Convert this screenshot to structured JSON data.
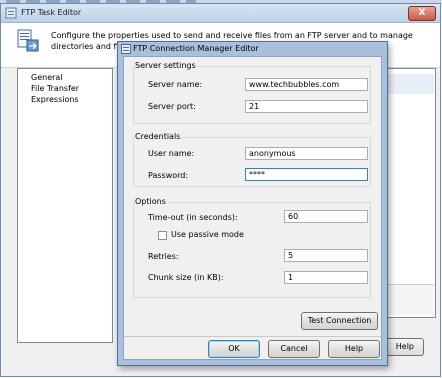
{
  "outer_window": {
    "title": "FTP Task Editor",
    "close_glyph": "X",
    "description": "Configure the properties used to send and receive files from an FTP server and to manage directories and files on local and remote servers.",
    "nav_items": [
      "General",
      "File Transfer",
      "Expressions"
    ],
    "help_label": "Help"
  },
  "dialog": {
    "title": "FTP Connection Manager Editor",
    "server_settings": {
      "title": "Server settings",
      "server_name_label": "Server name:",
      "server_name_value": "www.techbubbles.com",
      "server_port_label": "Server port:",
      "server_port_value": "21"
    },
    "credentials": {
      "title": "Credentials",
      "user_name_label": "User name:",
      "user_name_value": "anonymous",
      "password_label": "Password:",
      "password_value": "****"
    },
    "options": {
      "title": "Options",
      "timeout_label": "Time-out (in seconds):",
      "timeout_value": "60",
      "passive_label": "Use passive mode",
      "passive_checked": false,
      "retries_label": "Retries:",
      "retries_value": "5",
      "chunk_label": "Chunk size (in KB):",
      "chunk_value": "1"
    },
    "test_connection_label": "Test Connection",
    "ok_label": "OK",
    "cancel_label": "Cancel",
    "help_label": "Help"
  }
}
